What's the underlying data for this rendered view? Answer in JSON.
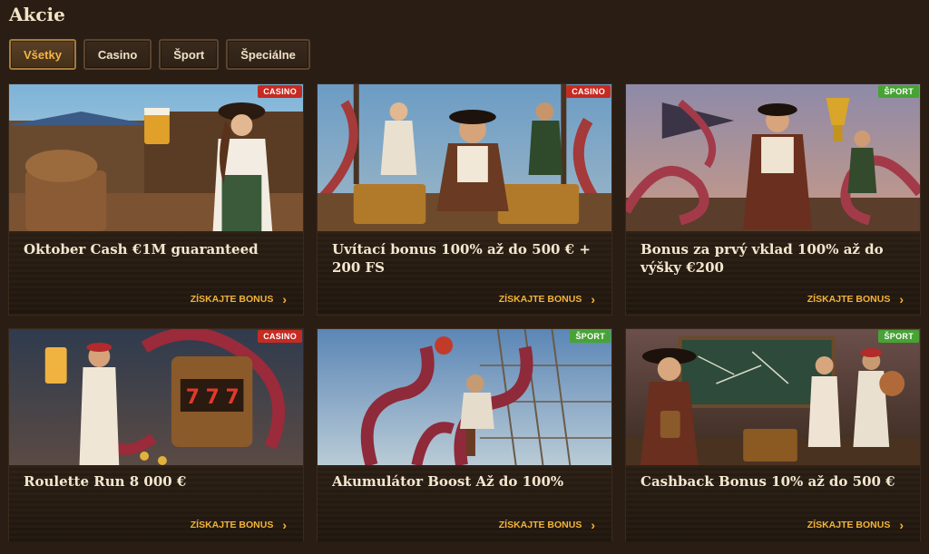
{
  "page": {
    "title": "Akcie"
  },
  "filters": [
    {
      "label": "Všetky",
      "active": true
    },
    {
      "label": "Casino",
      "active": false
    },
    {
      "label": "Šport",
      "active": false
    },
    {
      "label": "Špeciálne",
      "active": false
    }
  ],
  "cards": [
    {
      "badge": "CASINO",
      "badge_type": "casino",
      "title": "Oktober Cash €1M guaranteed",
      "cta": "ZÍSKAJTE BONUS",
      "art": "pirate-tavern-illustration"
    },
    {
      "badge": "CASINO",
      "badge_type": "casino",
      "title": "Uvítací bonus 100% až do 500 € + 200 FS",
      "cta": "ZÍSKAJTE BONUS",
      "art": "pirate-crew-treasure-illustration"
    },
    {
      "badge": "ŠPORT",
      "badge_type": "sport",
      "title": "Bonus za prvý vklad 100% až do výšky €200",
      "cta": "ZÍSKAJTE BONUS",
      "art": "pirate-trophy-kraken-illustration"
    },
    {
      "badge": "CASINO",
      "badge_type": "casino",
      "title": "Roulette Run 8 000 €",
      "cta": "ZÍSKAJTE BONUS",
      "art": "pirate-slot-machine-illustration"
    },
    {
      "badge": "ŠPORT",
      "badge_type": "sport",
      "title": "Akumulátor Boost Až do 100%",
      "cta": "ZÍSKAJTE BONUS",
      "art": "kraken-football-illustration"
    },
    {
      "badge": "ŠPORT",
      "badge_type": "sport",
      "title": "Cashback Bonus 10% až do 500 €",
      "cta": "ZÍSKAJTE BONUS",
      "art": "pirate-crew-tactics-illustration"
    }
  ],
  "colors": {
    "accent": "#f2b33b",
    "casino_badge": "#c62b22",
    "sport_badge": "#47a335",
    "background": "#2a1e14"
  }
}
